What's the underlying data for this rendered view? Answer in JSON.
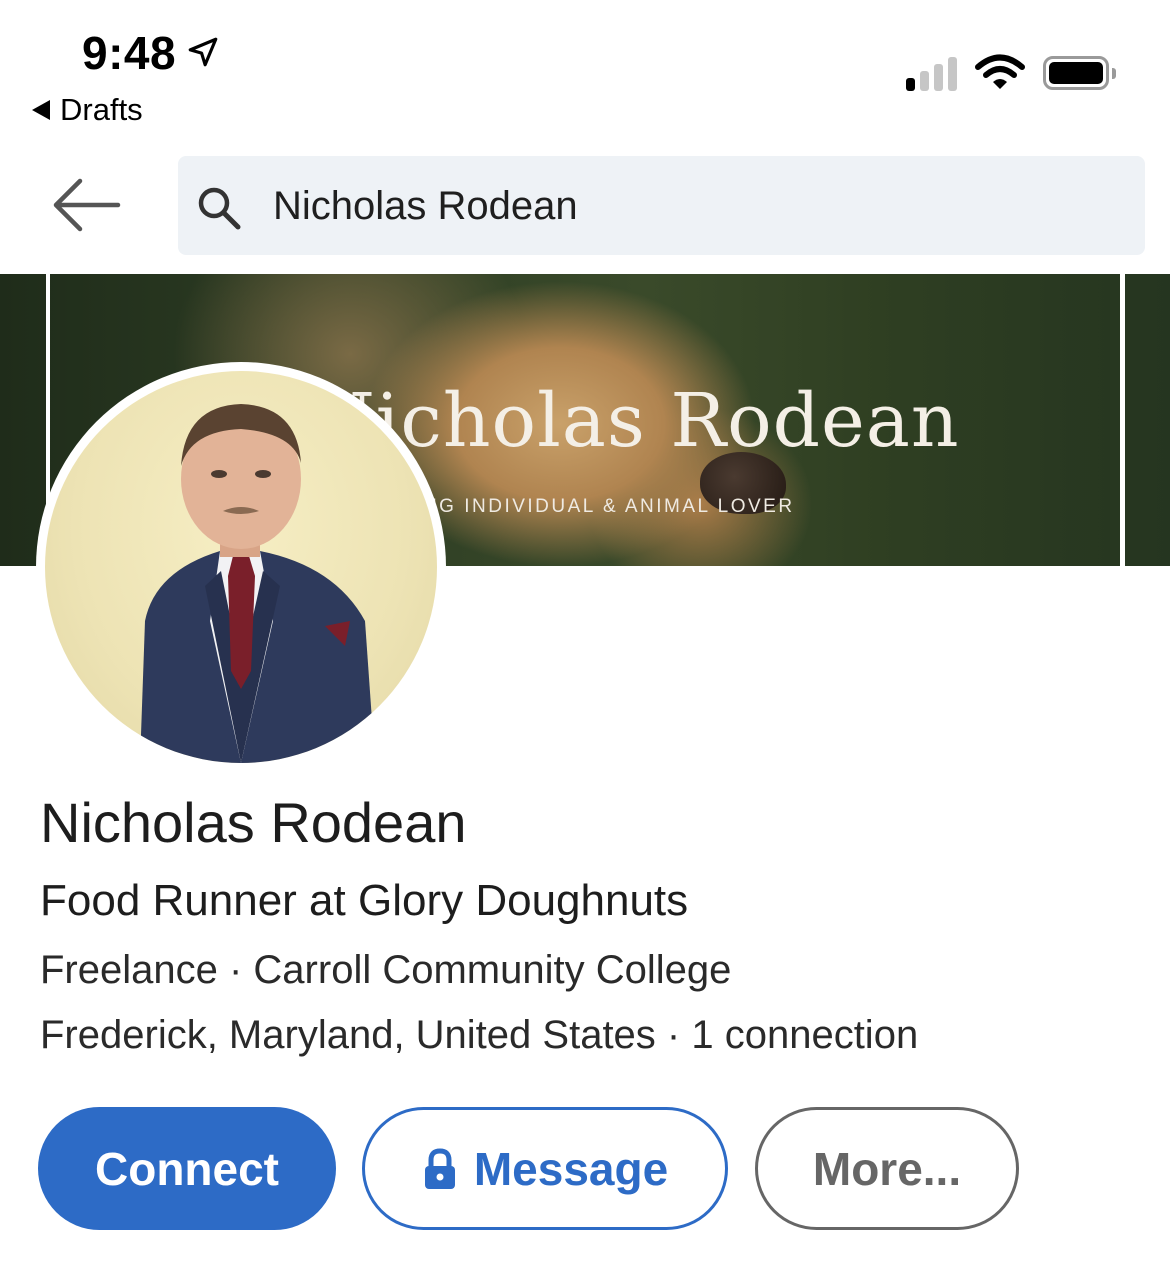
{
  "status_bar": {
    "time": "9:48",
    "location_icon": "location-arrow-icon",
    "back_app_label": "Drafts",
    "signal_icon": "cellular-signal-icon",
    "wifi_icon": "wifi-icon",
    "battery_icon": "battery-icon",
    "signal_bars_active": 1,
    "signal_bars_total": 4,
    "battery_level": 1.0
  },
  "header": {
    "back_icon": "back-arrow-icon",
    "search_icon": "search-icon",
    "search_value": "Nicholas Rodean"
  },
  "banner": {
    "title": "Nicholas Rodean",
    "tagline": "KING INDIVIDUAL &  ANIMAL LOVER"
  },
  "profile": {
    "name": "Nicholas Rodean",
    "headline": "Food Runner at Glory Doughnuts",
    "education_line": "Freelance · Carroll Community College",
    "location_line": "Frederick, Maryland, United States · 1 connection"
  },
  "actions": {
    "connect_label": "Connect",
    "message_label": "Message",
    "message_icon": "lock-icon",
    "more_label": "More..."
  },
  "colors": {
    "primary_blue": "#2d6bc6",
    "search_bg": "#eef2f6",
    "more_gray": "#666666"
  }
}
